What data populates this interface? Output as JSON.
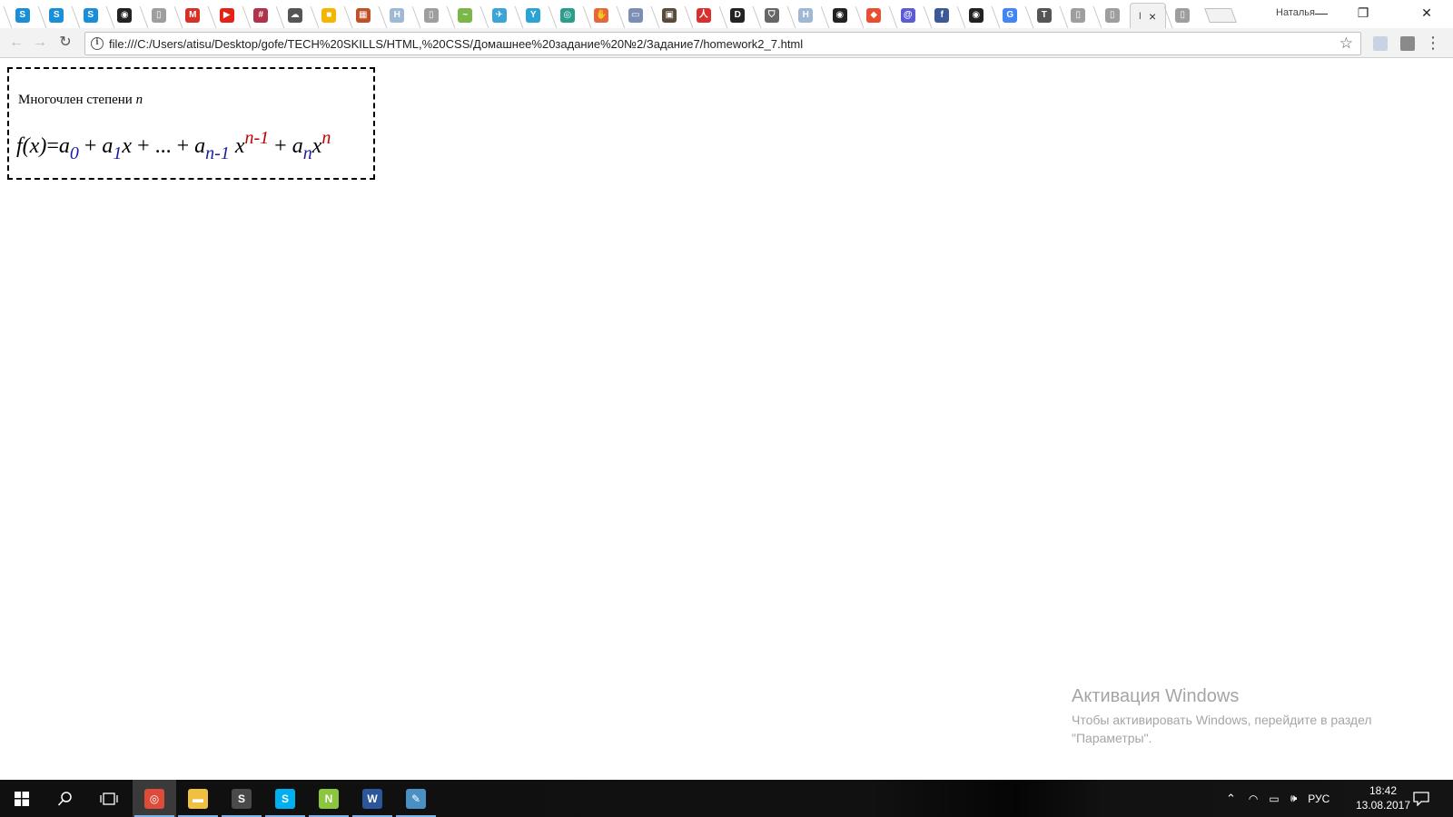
{
  "browser": {
    "tabs": [
      {
        "icon": "skype-icon",
        "color": "#1a8fd8",
        "glyph": "S"
      },
      {
        "icon": "skype-icon",
        "color": "#1a8fd8",
        "glyph": "S"
      },
      {
        "icon": "skype-icon",
        "color": "#1a8fd8",
        "glyph": "S"
      },
      {
        "icon": "github-icon",
        "color": "#222222",
        "glyph": "◉"
      },
      {
        "icon": "document-icon",
        "color": "#9e9e9e",
        "glyph": "▯"
      },
      {
        "icon": "gmail-icon",
        "color": "#d93025",
        "glyph": "M"
      },
      {
        "icon": "youtube-icon",
        "color": "#e62117",
        "glyph": "▶"
      },
      {
        "icon": "slack-icon",
        "color": "#b0334a",
        "glyph": "#"
      },
      {
        "icon": "cloud-icon",
        "color": "#555555",
        "glyph": "☁"
      },
      {
        "icon": "slides-icon",
        "color": "#f4b400",
        "glyph": "■"
      },
      {
        "icon": "blocks-icon",
        "color": "#c0502a",
        "glyph": "▦"
      },
      {
        "icon": "hexlet-icon",
        "color": "#9fb8d6",
        "glyph": "H"
      },
      {
        "icon": "document-icon",
        "color": "#9e9e9e",
        "glyph": "▯"
      },
      {
        "icon": "green-app-icon",
        "color": "#7ab648",
        "glyph": "~"
      },
      {
        "icon": "bird-icon",
        "color": "#3ba5d8",
        "glyph": "✈"
      },
      {
        "icon": "filter-icon",
        "color": "#2aa4d6",
        "glyph": "Y"
      },
      {
        "icon": "target-icon",
        "color": "#2a9d8f",
        "glyph": "◎"
      },
      {
        "icon": "hand-icon",
        "color": "#e4683a",
        "glyph": "✋"
      },
      {
        "icon": "monitor-icon",
        "color": "#7b8fb5",
        "glyph": "▭"
      },
      {
        "icon": "image-icon",
        "color": "#5a4a3a",
        "glyph": "▣"
      },
      {
        "icon": "person-icon",
        "color": "#d83030",
        "glyph": "人"
      },
      {
        "icon": "dou-icon",
        "color": "#222222",
        "glyph": "D"
      },
      {
        "icon": "shield-icon",
        "color": "#666666",
        "glyph": "⛉"
      },
      {
        "icon": "hexlet-icon",
        "color": "#9fb8d6",
        "glyph": "H"
      },
      {
        "icon": "github-icon",
        "color": "#222222",
        "glyph": "◉"
      },
      {
        "icon": "git-icon",
        "color": "#e84e31",
        "glyph": "◆"
      },
      {
        "icon": "at-icon",
        "color": "#5b5bd6",
        "glyph": "@"
      },
      {
        "icon": "facebook-icon",
        "color": "#3b5998",
        "glyph": "f"
      },
      {
        "icon": "github-icon",
        "color": "#222222",
        "glyph": "◉"
      },
      {
        "icon": "google-icon",
        "color": "#4285f4",
        "glyph": "G"
      },
      {
        "icon": "trello-icon",
        "color": "#555555",
        "glyph": "T"
      },
      {
        "icon": "document-icon",
        "color": "#9e9e9e",
        "glyph": "▯"
      },
      {
        "icon": "document-icon",
        "color": "#9e9e9e",
        "glyph": "▯"
      }
    ],
    "active_tab": {
      "glyph": "I",
      "close": "×"
    },
    "after_tab_icon": {
      "icon": "document-icon",
      "color": "#9e9e9e",
      "glyph": "▯"
    },
    "profile_name": "Наталья",
    "window_controls": {
      "minimize": "—",
      "restore": "❐",
      "close": "✕"
    },
    "nav": {
      "back": "←",
      "forward": "→",
      "reload": "↻"
    },
    "address": "file:///C:/Users/atisu/Desktop/gofe/TECH%20SKILLS/HTML,%20CSS/Домашнее%20задание%20№2/Задание7/homework2_7.html",
    "star": "☆",
    "menu": "⋮"
  },
  "page": {
    "caption_text": "Многочлен степени ",
    "caption_var": "n",
    "formula": {
      "f": "f(x)",
      "eq": "=",
      "a": "a",
      "a0_sub": "0",
      "plus1": " + ",
      "a1_sub": "1",
      "x1": "x",
      "plus2": " + ",
      "dots": "...",
      "plus3": " + ",
      "an1_sub": "n-1",
      "x2": "x",
      "an1_sup": "n-1",
      "plus4": " + ",
      "an_sub": "n",
      "x3": "x",
      "an_sup": "n"
    }
  },
  "watermark": {
    "title": "Активация Windows",
    "text": "Чтобы активировать Windows, перейдите в раздел \"Параметры\"."
  },
  "taskbar": {
    "apps": [
      {
        "name": "chrome",
        "icon": "chrome-icon",
        "color": "#dd4b39",
        "glyph": "◎"
      },
      {
        "name": "explorer",
        "icon": "folder-icon",
        "color": "#f0c040",
        "glyph": "▬"
      },
      {
        "name": "sublime",
        "icon": "sublime-icon",
        "color": "#4a4a4a",
        "glyph": "S"
      },
      {
        "name": "skype",
        "icon": "skype-icon",
        "color": "#00aff0",
        "glyph": "S"
      },
      {
        "name": "notepadpp",
        "icon": "notepad-plus-icon",
        "color": "#8cc63f",
        "glyph": "N"
      },
      {
        "name": "word",
        "icon": "word-icon",
        "color": "#2b579a",
        "glyph": "W"
      },
      {
        "name": "paint",
        "icon": "paint-icon",
        "color": "#4a90c2",
        "glyph": "✎"
      }
    ],
    "language": "РУС",
    "time": "18:42",
    "date": "13.08.2017"
  }
}
